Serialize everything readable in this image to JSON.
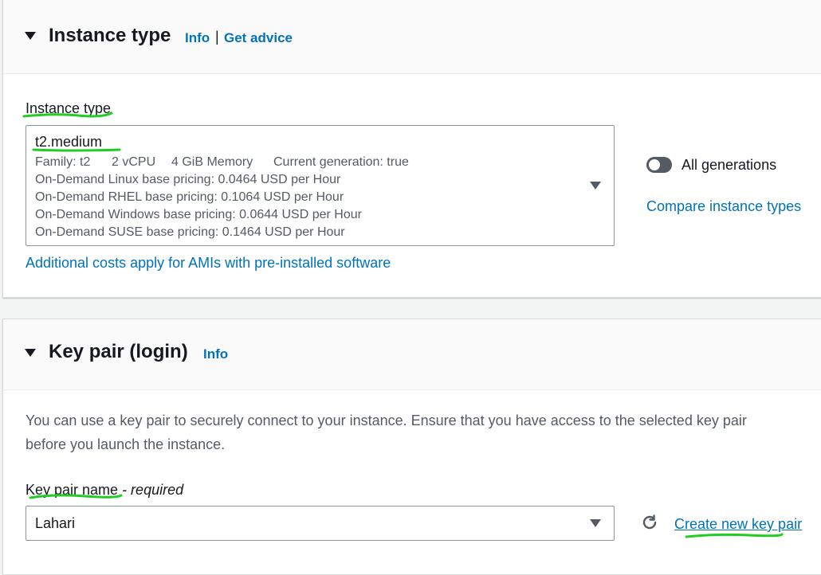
{
  "instance_type_section": {
    "title": "Instance type",
    "info_link": "Info",
    "separator": "|",
    "get_advice_link": "Get advice",
    "field_label": "Instance type",
    "selected": {
      "name": "t2.medium",
      "family": "Family: t2",
      "vcpu": "2 vCPU",
      "memory": "4 GiB Memory",
      "generation": "Current generation: true",
      "pricing": [
        "On-Demand Linux base pricing: 0.0464 USD per Hour",
        "On-Demand RHEL base pricing: 0.1064 USD per Hour",
        "On-Demand Windows base pricing: 0.0644 USD per Hour",
        "On-Demand SUSE base pricing: 0.1464 USD per Hour"
      ]
    },
    "all_generations_label": "All generations",
    "all_generations_on": false,
    "compare_link": "Compare instance types",
    "additional_costs_link": "Additional costs apply for AMIs with pre-installed software"
  },
  "key_pair_section": {
    "title": "Key pair (login)",
    "info_link": "Info",
    "description_line1": "You can use a key pair to securely connect to your instance. Ensure that you have access to the selected key pair",
    "description_line2": "before you launch the instance.",
    "field_label": "Key pair name",
    "field_label_suffix": " - required",
    "selected_value": "Lahari",
    "refresh_icon": "refresh-icon",
    "create_link": "Create new key pair"
  },
  "annotation_color": "#22cc22",
  "colors": {
    "link": "#0073bb",
    "text": "#16191f",
    "secondary": "#545b64"
  }
}
